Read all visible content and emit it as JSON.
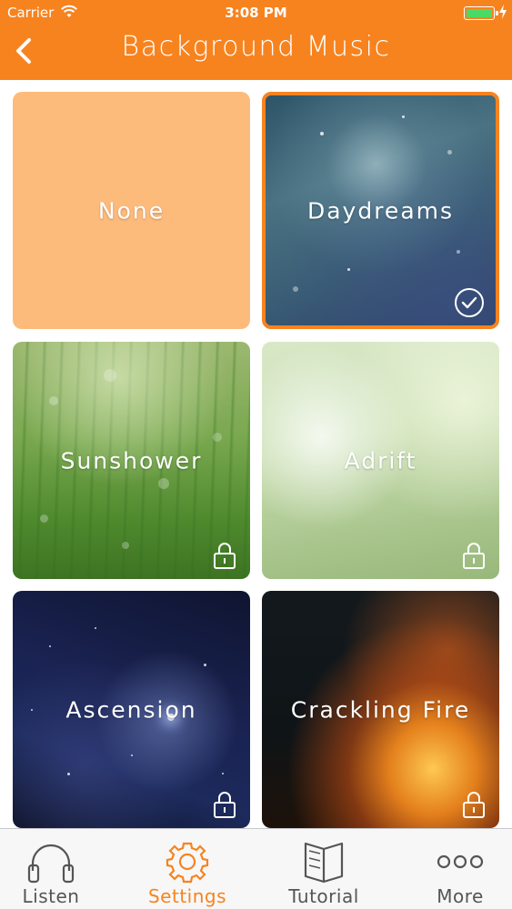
{
  "status_bar": {
    "carrier": "Carrier",
    "time": "3:08 PM",
    "battery_color": "#4cd964"
  },
  "nav": {
    "title": "Background Music",
    "back_icon": "chevron-left-icon",
    "color": "#f7831f"
  },
  "tracks": [
    {
      "name": "None",
      "selected": false,
      "locked": false
    },
    {
      "name": "Daydreams",
      "selected": true,
      "locked": false
    },
    {
      "name": "Sunshower",
      "selected": false,
      "locked": true
    },
    {
      "name": "Adrift",
      "selected": false,
      "locked": true
    },
    {
      "name": "Ascension",
      "selected": false,
      "locked": true
    },
    {
      "name": "Crackling Fire",
      "selected": false,
      "locked": true
    }
  ],
  "tabbar": {
    "tabs": [
      {
        "label": "Listen",
        "icon": "headphones-icon",
        "active": false
      },
      {
        "label": "Settings",
        "icon": "gear-icon",
        "active": true
      },
      {
        "label": "Tutorial",
        "icon": "book-icon",
        "active": false
      },
      {
        "label": "More",
        "icon": "more-dots-icon",
        "active": false
      }
    ],
    "active_color": "#f7831f"
  }
}
